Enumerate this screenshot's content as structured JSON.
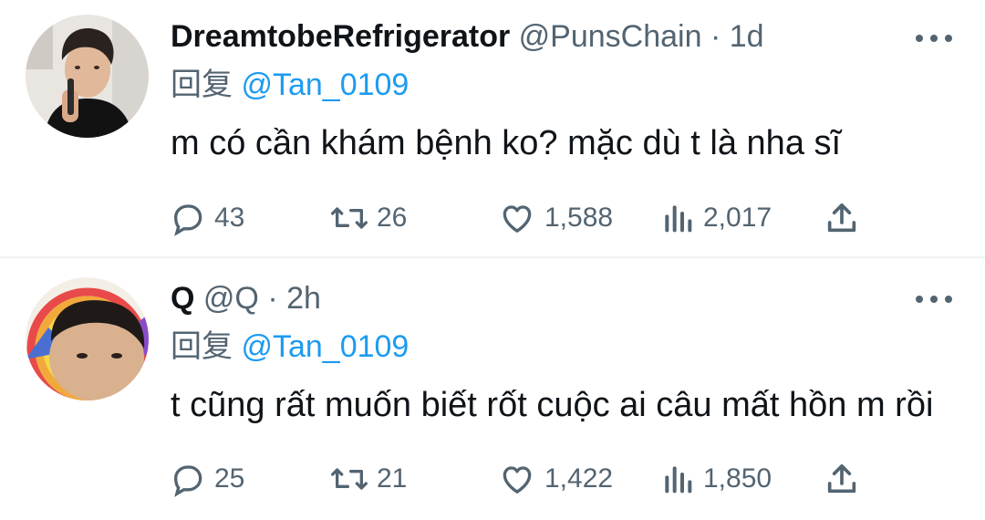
{
  "tweets": [
    {
      "display_name": "DreamtobeRefrigerator",
      "handle": "@PunsChain",
      "separator": "·",
      "time": "1d",
      "reply_prefix": "回复",
      "reply_to": "@Tan_0109",
      "text": "m có cần khám bệnh ko? mặc dù t là nha sĩ",
      "replies": "43",
      "retweets": "26",
      "likes": "1,588",
      "views": "2,017",
      "avatar_icon": "person-with-microphone-photo"
    },
    {
      "display_name": "Q",
      "handle": "@Q",
      "separator": "·",
      "time": "2h",
      "reply_prefix": "回复",
      "reply_to": "@Tan_0109",
      "text": "t cũng rất muốn biết rốt cuộc ai câu mất hồn m rồi",
      "replies": "25",
      "retweets": "21",
      "likes": "1,422",
      "views": "1,850",
      "avatar_icon": "person-with-rainbow-photo"
    }
  ],
  "colors": {
    "text_primary": "#0f1419",
    "text_secondary": "#536471",
    "link": "#1d9bf0",
    "divider": "#eff3f4"
  },
  "icons": [
    "reply-icon",
    "retweet-icon",
    "like-icon",
    "views-icon",
    "share-icon",
    "more-icon"
  ]
}
